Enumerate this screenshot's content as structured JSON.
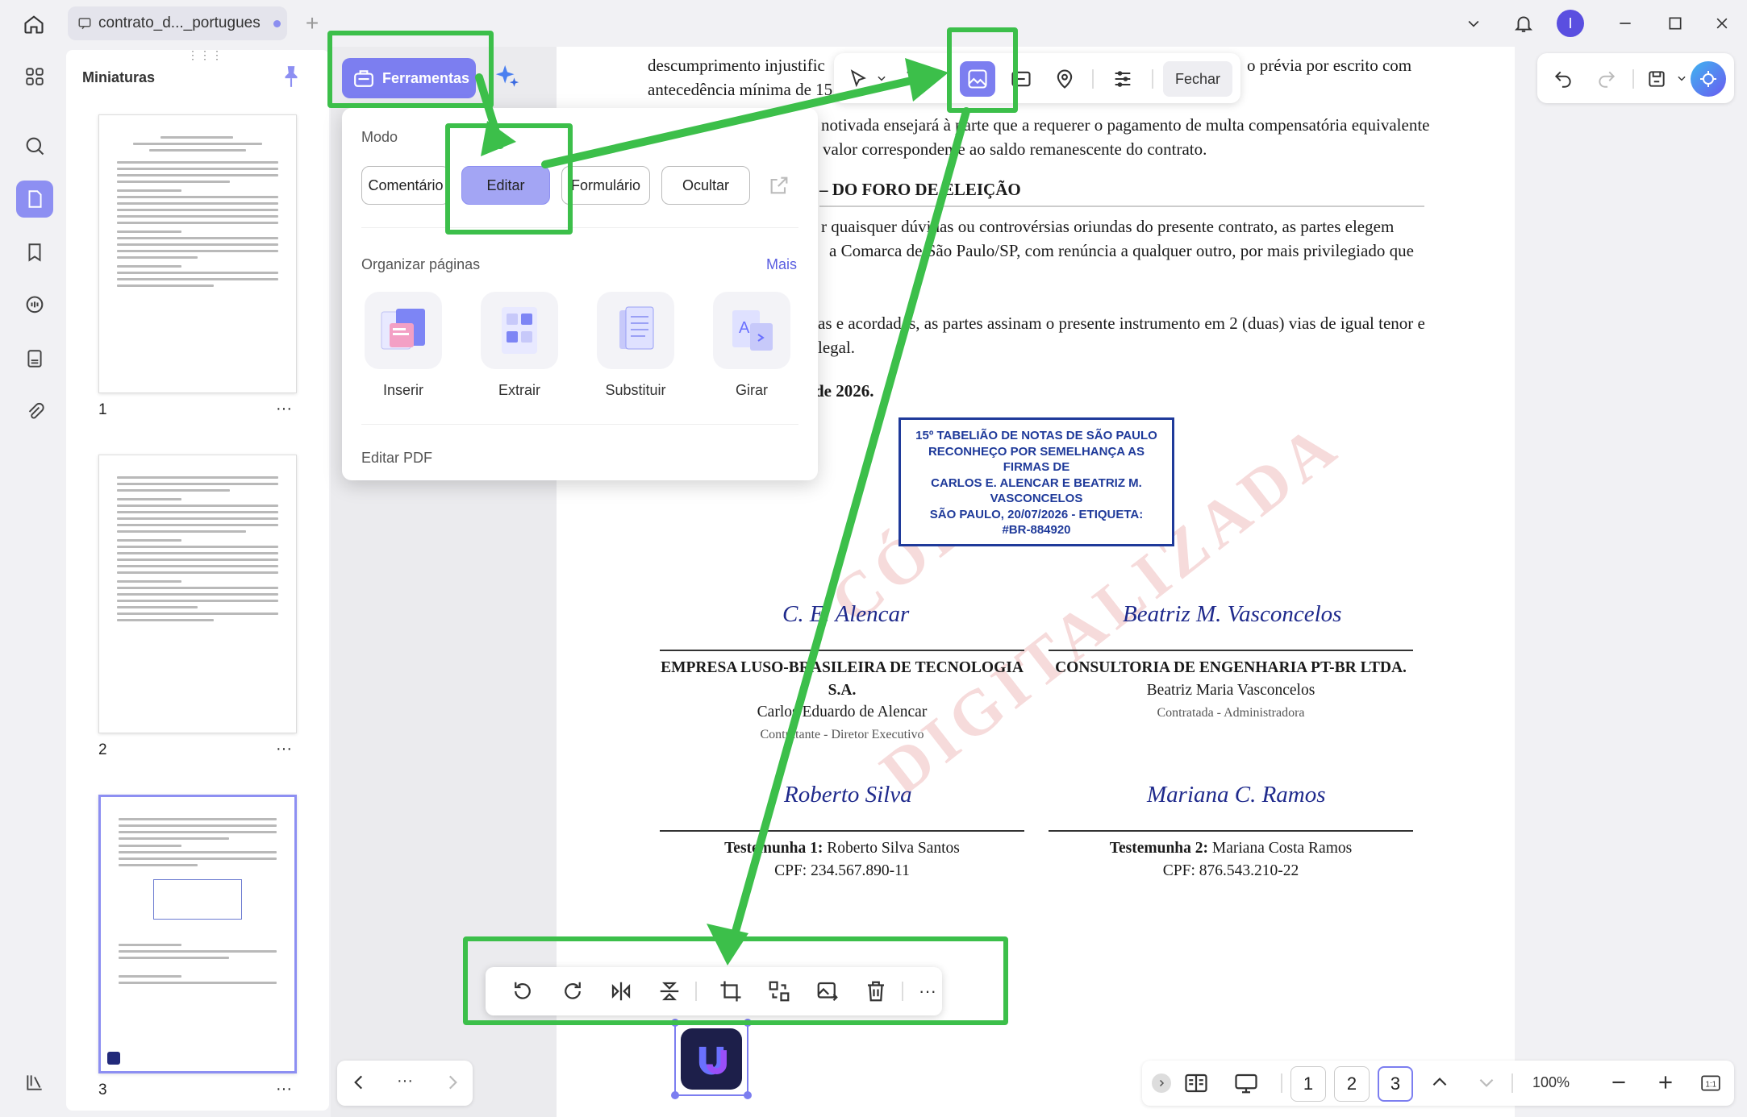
{
  "tab": {
    "title": "contrato_d..._portugues"
  },
  "window": {
    "avatar_letter": "I"
  },
  "sidebar": {
    "title": "Miniaturas",
    "pages": [
      "1",
      "2",
      "3"
    ],
    "more": "···"
  },
  "tools": {
    "button_label": "Ferramentas"
  },
  "dropdown": {
    "mode_heading": "Modo",
    "modes": [
      "Comentário",
      "Editar",
      "Formulário",
      "Ocultar"
    ],
    "active_mode": "Editar",
    "organize_heading": "Organizar páginas",
    "more_link": "Mais",
    "organize_items": [
      "Inserir",
      "Extrair",
      "Substituir",
      "Girar"
    ],
    "edit_pdf": "Editar PDF"
  },
  "toolbar": {
    "close_label": "Fechar"
  },
  "document": {
    "line1": "descumprimento injustific",
    "line1_right": "o prévia por escrito com",
    "line2": "antecedência mínima de 15",
    "line3": "notivada ensejará à parte que a requerer o pagamento de multa compensatória equivalente",
    "line4": "valor correspondente ao saldo remanescente do contrato.",
    "heading": "– DO FORO DE ELEIÇÃO",
    "line5": "r quaisquer dúvidas ou controvérsias oriundas do presente contrato, as partes elegem",
    "line6": "a Comarca de São Paulo/SP, com renúncia a qualquer outro, por mais privilegiado que",
    "line7": "as e acordadas, as partes assinam o presente instrumento em 2 (duas) vias de igual tenor e",
    "line8": "legal.",
    "date": "de 2026.",
    "stamp": [
      "15º TABELIÃO DE NOTAS DE SÃO PAULO",
      "RECONHEÇO POR SEMELHANÇA AS",
      "FIRMAS DE",
      "CARLOS E. ALENCAR E BEATRIZ M.",
      "VASCONCELOS",
      "SÃO PAULO, 20/07/2026 - ETIQUETA:",
      "#BR-884920"
    ],
    "watermark": [
      "CÓPIA",
      "DIGITALIZADA"
    ],
    "sig1": {
      "script": "C. E. Alencar",
      "company": "EMPRESA LUSO-BRASILEIRA DE TECNOLOGIA",
      "company2": "S.A.",
      "name": "Carlos Eduardo de Alencar",
      "role": "Contratante - Diretor Executivo"
    },
    "sig2": {
      "script": "Beatriz M. Vasconcelos",
      "company": "CONSULTORIA DE ENGENHARIA PT-BR LTDA.",
      "name": "Beatriz Maria Vasconcelos",
      "role": "Contratada - Administradora"
    },
    "sig3": {
      "script": "Roberto Silva",
      "label": "Testemunha 1:",
      "name": " Roberto Silva Santos",
      "cpf": "CPF: 234.567.890-11"
    },
    "sig4": {
      "script": "Mariana C. Ramos",
      "label": "Testemunha 2:",
      "name": " Mariana Costa Ramos",
      "cpf": "CPF: 876.543.210-22"
    }
  },
  "bottom": {
    "pages": [
      "1",
      "2",
      "3"
    ],
    "current_page": "3",
    "zoom": "100%",
    "more": "···"
  },
  "colors": {
    "accent": "#7c7ef0",
    "highlight": "#3cbf4a"
  }
}
